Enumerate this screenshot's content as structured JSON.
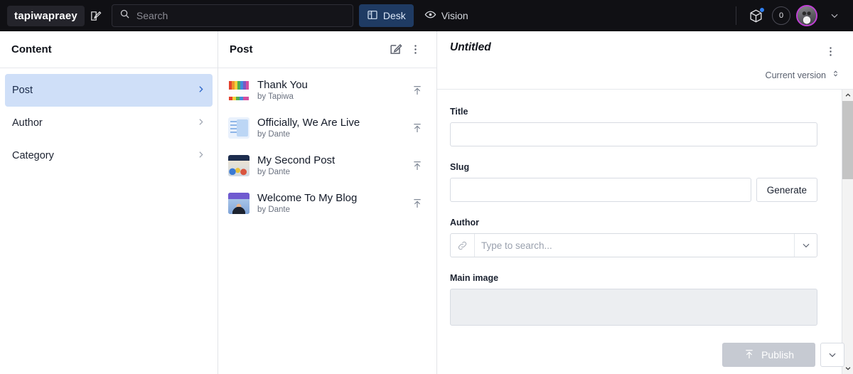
{
  "topbar": {
    "logo": "tapiwapraey",
    "compose_icon": "compose-icon",
    "search": {
      "placeholder": "Search",
      "value": "",
      "icon": "search-icon"
    },
    "tabs": [
      {
        "label": "Desk",
        "icon": "desk-icon",
        "active": true
      },
      {
        "label": "Vision",
        "icon": "eye-icon",
        "active": false
      }
    ],
    "package_icon": "package-icon",
    "notification_dot": true,
    "count": "0",
    "avatar": "user-avatar",
    "avatar_ring_color": "#c13fd6",
    "active_tab_bg": "#1f3b63",
    "background": "#101014"
  },
  "content_pane": {
    "title": "Content",
    "items": [
      {
        "label": "Post",
        "active": true
      },
      {
        "label": "Author",
        "active": false
      },
      {
        "label": "Category",
        "active": false
      }
    ],
    "active_bg": "#cfdff8"
  },
  "list_pane": {
    "title": "Post",
    "compose_icon": "compose-icon",
    "menu_icon": "kebab-menu-icon",
    "posts": [
      {
        "title": "Thank You",
        "by": "by Tapiwa",
        "thumb": "t-thanks",
        "action_icon": "publish-arrow-icon"
      },
      {
        "title": "Officially, We Are Live",
        "by": "by Dante",
        "thumb": "t-doc",
        "action_icon": "publish-arrow-icon"
      },
      {
        "title": "My Second Post",
        "by": "by Dante",
        "thumb": "t-tech",
        "action_icon": "publish-arrow-icon"
      },
      {
        "title": "Welcome To My Blog",
        "by": "by Dante",
        "thumb": "t-prod",
        "action_icon": "publish-arrow-icon"
      }
    ]
  },
  "editor": {
    "title": "Untitled",
    "menu_icon": "kebab-menu-icon",
    "version_label": "Current version",
    "version_icon": "chevron-updown-icon",
    "fields": {
      "title": {
        "label": "Title",
        "value": "",
        "placeholder": ""
      },
      "slug": {
        "label": "Slug",
        "value": "",
        "placeholder": "",
        "button": "Generate"
      },
      "author": {
        "label": "Author",
        "value": "",
        "placeholder": "Type to search...",
        "icon": "link-icon",
        "chevron": "chevron-down-icon"
      },
      "main_image": {
        "label": "Main image"
      }
    },
    "publish": {
      "label": "Publish",
      "icon": "publish-arrow-icon",
      "disabled": true,
      "chevron": "chevron-down-icon"
    },
    "scrollbar": {
      "up": "chevron-up-icon",
      "down": "chevron-down-icon"
    }
  }
}
